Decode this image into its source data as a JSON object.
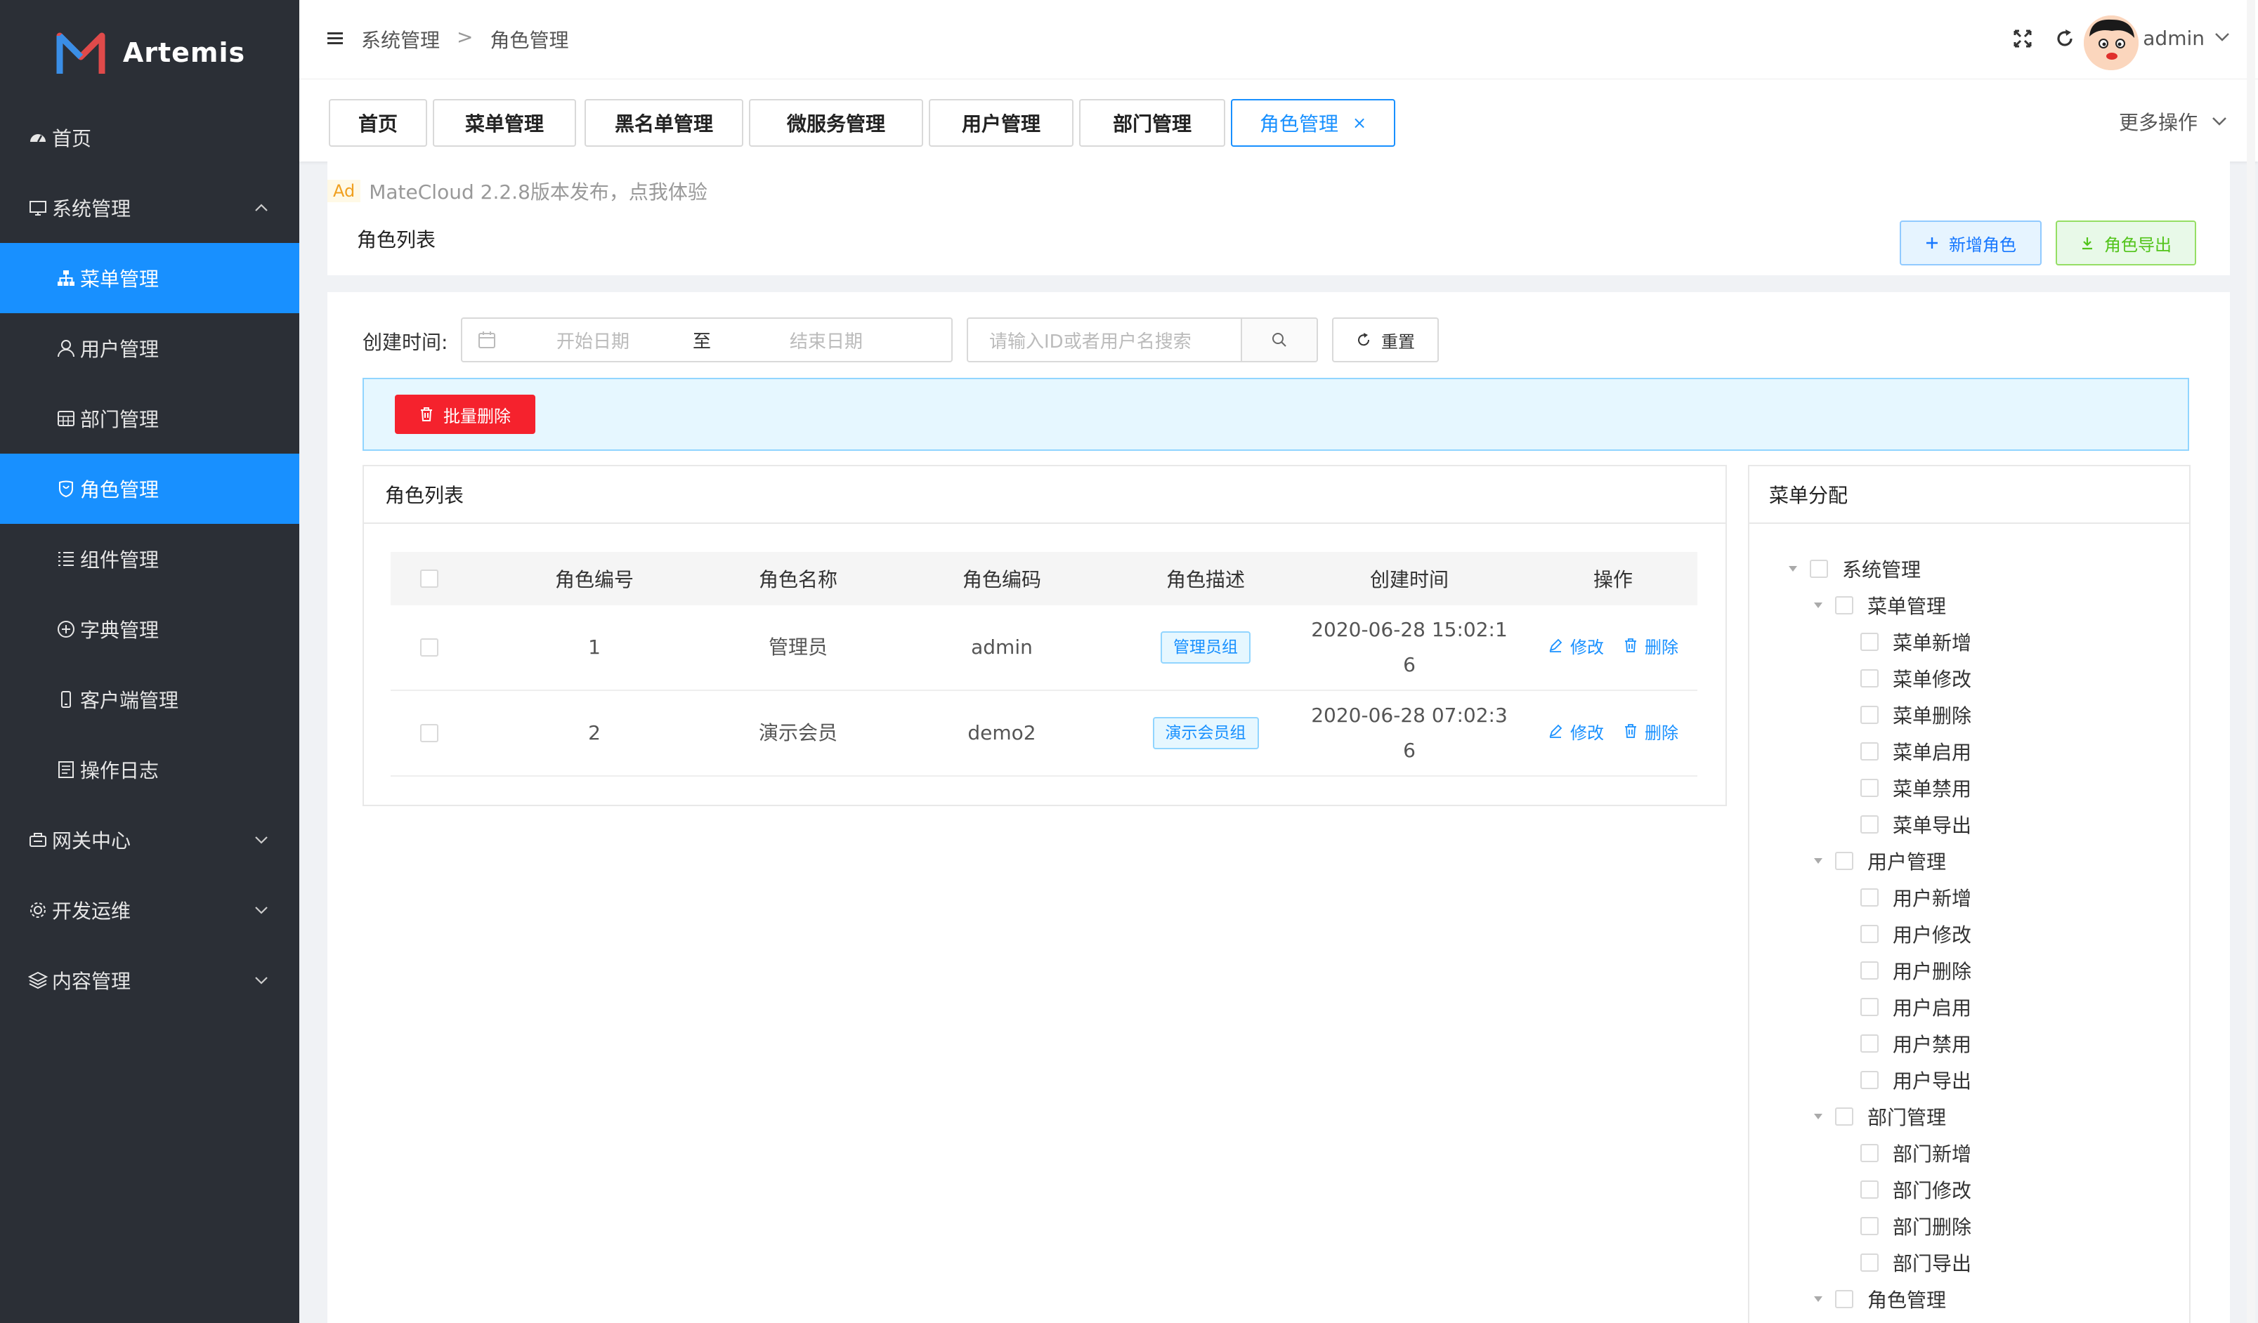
{
  "app": {
    "name": "Artemis"
  },
  "sidebar": {
    "items": [
      {
        "label": "首页",
        "icon": "dashboard-icon"
      },
      {
        "label": "系统管理",
        "icon": "desktop-icon",
        "expanded": true
      },
      {
        "label": "菜单管理",
        "icon": "sitemap-icon",
        "active": true
      },
      {
        "label": "用户管理",
        "icon": "user-icon"
      },
      {
        "label": "部门管理",
        "icon": "calculator-icon"
      },
      {
        "label": "角色管理",
        "icon": "role-icon",
        "active": true
      },
      {
        "label": "组件管理",
        "icon": "list-icon"
      },
      {
        "label": "字典管理",
        "icon": "plus-circle-icon"
      },
      {
        "label": "客户端管理",
        "icon": "mobile-icon"
      },
      {
        "label": "操作日志",
        "icon": "log-icon"
      },
      {
        "label": "网关中心",
        "icon": "gateway-icon"
      },
      {
        "label": "开发运维",
        "icon": "gear-icon"
      },
      {
        "label": "内容管理",
        "icon": "layers-icon"
      }
    ]
  },
  "header": {
    "breadcrumb": [
      "系统管理",
      "角色管理"
    ],
    "breadcrumb_sep": ">",
    "username": "admin"
  },
  "tabs": {
    "items": [
      "首页",
      "菜单管理",
      "黑名单管理",
      "微服务管理",
      "用户管理",
      "部门管理",
      "角色管理"
    ],
    "active_index": 6,
    "close_glyph": "×",
    "more_ops": "更多操作"
  },
  "ad": {
    "badge": "Ad",
    "text": "MateCloud 2.2.8版本发布，点我体验"
  },
  "page": {
    "title": "角色列表",
    "add_button": "新增角色",
    "export_button": "角色导出"
  },
  "filter": {
    "label": "创建时间:",
    "start_placeholder": "开始日期",
    "range_sep": "至",
    "end_placeholder": "结束日期",
    "search_placeholder": "请输入ID或者用户名搜索",
    "reset_button": "重置",
    "batch_delete": "批量删除"
  },
  "role_table": {
    "title": "角色列表",
    "columns": [
      "角色编号",
      "角色名称",
      "角色编码",
      "角色描述",
      "创建时间",
      "操作"
    ],
    "rows": [
      {
        "id": "1",
        "name": "管理员",
        "code": "admin",
        "desc": "管理员组",
        "created_line1": "2020-06-28 15:02:1",
        "created_line2": "6"
      },
      {
        "id": "2",
        "name": "演示会员",
        "code": "demo2",
        "desc": "演示会员组",
        "created_line1": "2020-06-28 07:02:3",
        "created_line2": "6"
      }
    ],
    "edit_label": "修改",
    "delete_label": "删除"
  },
  "menu_tree": {
    "title": "菜单分配",
    "nodes": [
      {
        "label": "系统管理",
        "level": 0,
        "expandable": true
      },
      {
        "label": "菜单管理",
        "level": 1,
        "expandable": true
      },
      {
        "label": "菜单新增",
        "level": 2
      },
      {
        "label": "菜单修改",
        "level": 2
      },
      {
        "label": "菜单删除",
        "level": 2
      },
      {
        "label": "菜单启用",
        "level": 2
      },
      {
        "label": "菜单禁用",
        "level": 2
      },
      {
        "label": "菜单导出",
        "level": 2
      },
      {
        "label": "用户管理",
        "level": 1,
        "expandable": true
      },
      {
        "label": "用户新增",
        "level": 2
      },
      {
        "label": "用户修改",
        "level": 2
      },
      {
        "label": "用户删除",
        "level": 2
      },
      {
        "label": "用户启用",
        "level": 2
      },
      {
        "label": "用户禁用",
        "level": 2
      },
      {
        "label": "用户导出",
        "level": 2
      },
      {
        "label": "部门管理",
        "level": 1,
        "expandable": true
      },
      {
        "label": "部门新增",
        "level": 2
      },
      {
        "label": "部门修改",
        "level": 2
      },
      {
        "label": "部门删除",
        "level": 2
      },
      {
        "label": "部门导出",
        "level": 2
      },
      {
        "label": "角色管理",
        "level": 1,
        "expandable": true
      }
    ]
  },
  "colors": {
    "primary": "#1890ff",
    "sidebar_bg": "#2b2f36",
    "danger": "#f5222d",
    "success": "#52c41a"
  }
}
